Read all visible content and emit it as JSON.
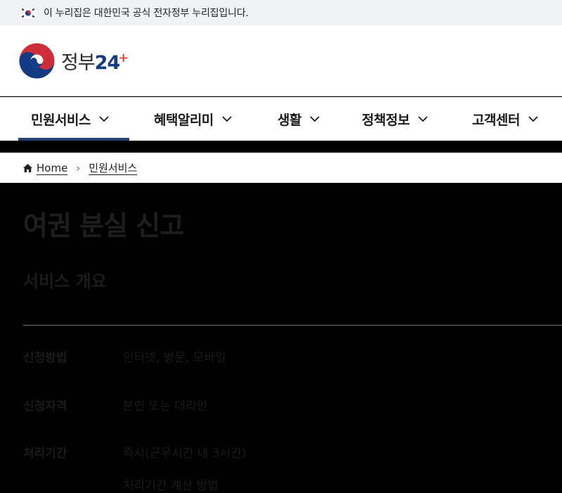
{
  "gov_banner": {
    "text": "이 누리집은 대한민국 공식 전자정부 누리집입니다."
  },
  "header": {
    "logo_ko": "정부",
    "logo_num": "24",
    "logo_plus": "+"
  },
  "nav": {
    "items": [
      {
        "label": "민원서비스",
        "active": true
      },
      {
        "label": "혜택알리미",
        "active": false
      },
      {
        "label": "생활",
        "active": false
      },
      {
        "label": "정책정보",
        "active": false
      },
      {
        "label": "고객센터",
        "active": false
      }
    ]
  },
  "breadcrumb": {
    "home": "Home",
    "current": "민원서비스"
  },
  "page": {
    "title": "여권 분실 신고",
    "section": "서비스 개요",
    "rows": [
      {
        "label": "신청방법",
        "value": "인터넷, 방문, 모바일"
      },
      {
        "label": "신청자격",
        "value": "본인 또는 대리인"
      },
      {
        "label": "처리기간",
        "value": "즉시(근무시간 내 3시간)"
      },
      {
        "label": "",
        "value": "처리기간 계산 방법"
      }
    ]
  },
  "colors": {
    "nav_active_underline": "#23406f",
    "logo_blue": "#123b84",
    "logo_red": "#e14b3b",
    "banner_bg": "#f0f2f5"
  }
}
